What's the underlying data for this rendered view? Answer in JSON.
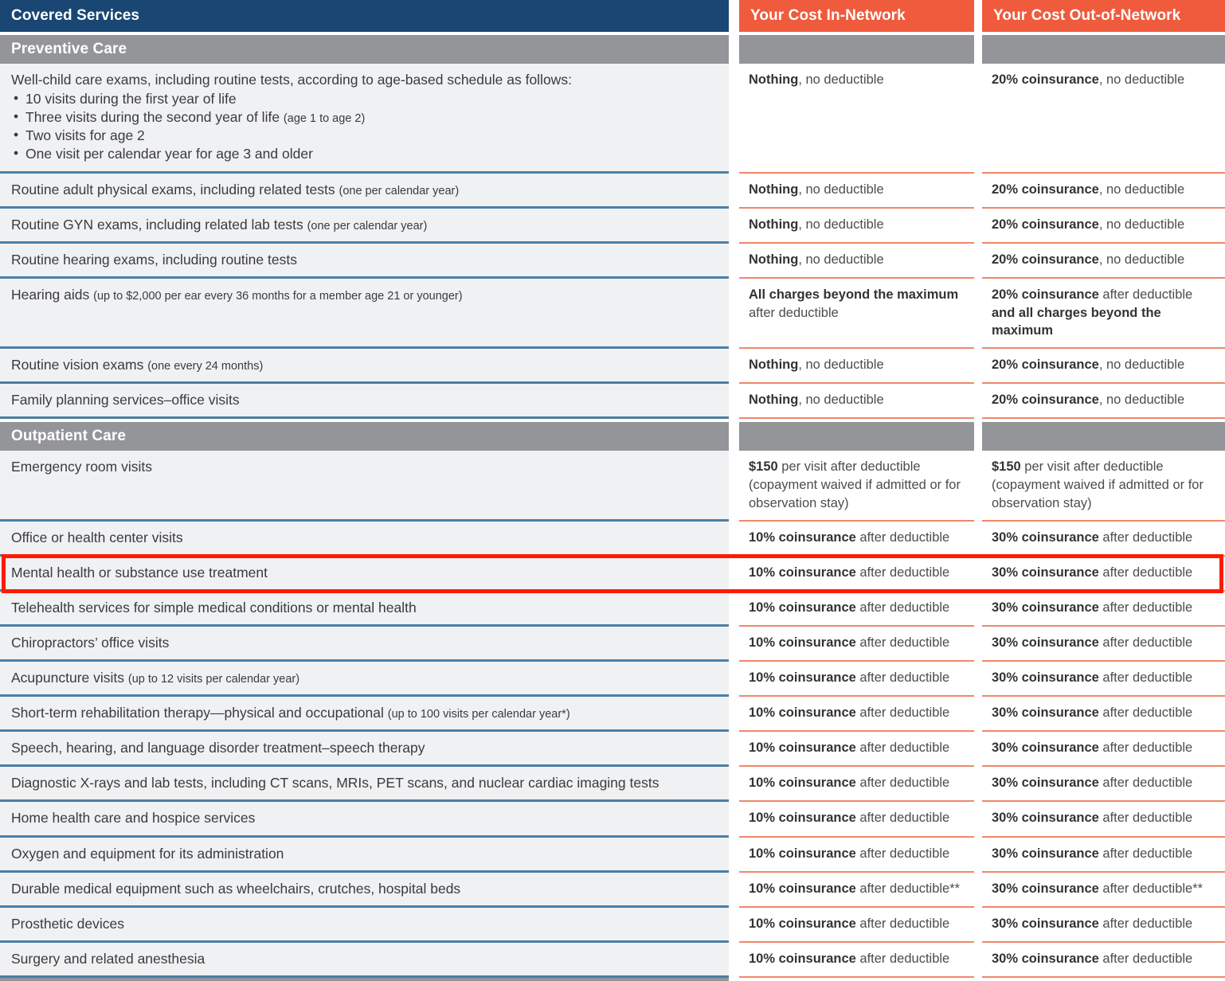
{
  "table": {
    "headers": {
      "service": "Covered Services",
      "in_network": "Your Cost In-Network",
      "out_network": "Your Cost Out-of-Network"
    },
    "sections": [
      {
        "title": "Preventive Care",
        "rows": [
          {
            "service_main": "Well-child care exams, including routine tests, according to age-based schedule as follows:",
            "bullets": [
              {
                "text": "10 visits during the first year of life",
                "note": ""
              },
              {
                "text": "Three visits during the second year of life",
                "note": "(age 1 to age 2)"
              },
              {
                "text": "Two visits for age 2",
                "note": ""
              },
              {
                "text": "One visit per calendar year for age 3 and older",
                "note": ""
              }
            ],
            "in_bold": "Nothing",
            "in_rest": ", no deductible",
            "out_bold": "20% coinsurance",
            "out_rest": ", no deductible"
          },
          {
            "service_main": "Routine adult physical exams, including related tests",
            "service_note": "(one per calendar year)",
            "in_bold": "Nothing",
            "in_rest": ", no deductible",
            "out_bold": "20% coinsurance",
            "out_rest": ", no deductible"
          },
          {
            "service_main": "Routine GYN exams, including related lab tests",
            "service_note": "(one per calendar year)",
            "in_bold": "Nothing",
            "in_rest": ", no deductible",
            "out_bold": "20% coinsurance",
            "out_rest": ", no deductible"
          },
          {
            "service_main": "Routine hearing exams, including routine tests",
            "service_note": "",
            "in_bold": "Nothing",
            "in_rest": ", no deductible",
            "out_bold": "20% coinsurance",
            "out_rest": ", no deductible"
          },
          {
            "service_main": "Hearing aids",
            "service_note": "(up to $2,000 per ear every 36 months for a member age 21 or younger)",
            "in_bold": "All charges beyond the maximum",
            "in_rest": " after deductible",
            "out_bold": "20% coinsurance",
            "out_rest": " after deductible",
            "out_bold2": "and all charges beyond the maximum"
          },
          {
            "service_main": "Routine vision exams",
            "service_note": "(one every 24 months)",
            "in_bold": "Nothing",
            "in_rest": ", no deductible",
            "out_bold": "20% coinsurance",
            "out_rest": ", no deductible"
          },
          {
            "service_main": "Family planning services–office visits",
            "service_note": "",
            "in_bold": "Nothing",
            "in_rest": ", no deductible",
            "out_bold": "20% coinsurance",
            "out_rest": ", no deductible"
          }
        ]
      },
      {
        "title": "Outpatient Care",
        "rows": [
          {
            "service_main": "Emergency room visits",
            "service_note": "",
            "in_bold": "$150",
            "in_rest": " per visit after deductible (copayment waived if admitted or for observation stay)",
            "out_bold": "$150",
            "out_rest": " per visit after deductible (copayment waived if admitted or for observation stay)"
          },
          {
            "service_main": "Office or health center visits",
            "service_note": "",
            "in_bold": "10% coinsurance",
            "in_rest": " after deductible",
            "out_bold": "30% coinsurance",
            "out_rest": " after deductible"
          },
          {
            "service_main": "Mental health or substance use treatment",
            "service_note": "",
            "highlighted": true,
            "in_bold": "10% coinsurance",
            "in_rest": " after deductible",
            "out_bold": "30% coinsurance",
            "out_rest": " after deductible"
          },
          {
            "service_main": "Telehealth services for simple medical conditions or mental health",
            "service_note": "",
            "in_bold": "10% coinsurance",
            "in_rest": " after deductible",
            "out_bold": "30% coinsurance",
            "out_rest": " after deductible"
          },
          {
            "service_main": "Chiropractors’ office visits",
            "service_note": "",
            "in_bold": "10% coinsurance",
            "in_rest": " after deductible",
            "out_bold": "30% coinsurance",
            "out_rest": " after deductible"
          },
          {
            "service_main": "Acupuncture visits",
            "service_note": "(up to 12 visits per calendar year)",
            "in_bold": "10% coinsurance",
            "in_rest": " after deductible",
            "out_bold": "30% coinsurance",
            "out_rest": " after deductible"
          },
          {
            "service_main": "Short-term rehabilitation therapy—physical and occupational",
            "service_note": "(up to 100 visits per calendar year*)",
            "in_bold": "10% coinsurance",
            "in_rest": " after deductible",
            "out_bold": "30% coinsurance",
            "out_rest": " after deductible"
          },
          {
            "service_main": "Speech, hearing, and language disorder treatment–speech therapy",
            "service_note": "",
            "in_bold": "10% coinsurance",
            "in_rest": " after deductible",
            "out_bold": "30% coinsurance",
            "out_rest": " after deductible"
          },
          {
            "service_main": "Diagnostic X-rays and lab tests, including CT scans, MRIs, PET scans, and nuclear cardiac imaging tests",
            "service_note": "",
            "in_bold": "10% coinsurance",
            "in_rest": " after deductible",
            "out_bold": "30% coinsurance",
            "out_rest": " after deductible"
          },
          {
            "service_main": "Home health care and hospice services",
            "service_note": "",
            "in_bold": "10% coinsurance",
            "in_rest": " after deductible",
            "out_bold": "30% coinsurance",
            "out_rest": " after deductible"
          },
          {
            "service_main": "Oxygen and equipment for its administration",
            "service_note": "",
            "in_bold": "10% coinsurance",
            "in_rest": " after deductible",
            "out_bold": "30% coinsurance",
            "out_rest": " after deductible"
          },
          {
            "service_main": "Durable medical equipment such as wheelchairs, crutches, hospital beds",
            "service_note": "",
            "in_bold": "10% coinsurance",
            "in_rest": " after deductible**",
            "out_bold": "30% coinsurance",
            "out_rest": " after deductible**"
          },
          {
            "service_main": "Prosthetic devices",
            "service_note": "",
            "in_bold": "10% coinsurance",
            "in_rest": " after deductible",
            "out_bold": "30% coinsurance",
            "out_rest": " after deductible"
          },
          {
            "service_main": "Surgery and related anesthesia",
            "service_note": "",
            "in_bold": "10% coinsurance",
            "in_rest": " after deductible",
            "out_bold": "30% coinsurance",
            "out_rest": " after deductible"
          }
        ]
      }
    ]
  },
  "colors": {
    "header_navy": "#1a4673",
    "header_orange": "#ef5b3c",
    "section_grey": "#949598",
    "service_bg": "#f0f1f2",
    "service_border": "#4a7fa5",
    "cost_border": "#f0876a",
    "highlight": "#ff1a00"
  }
}
